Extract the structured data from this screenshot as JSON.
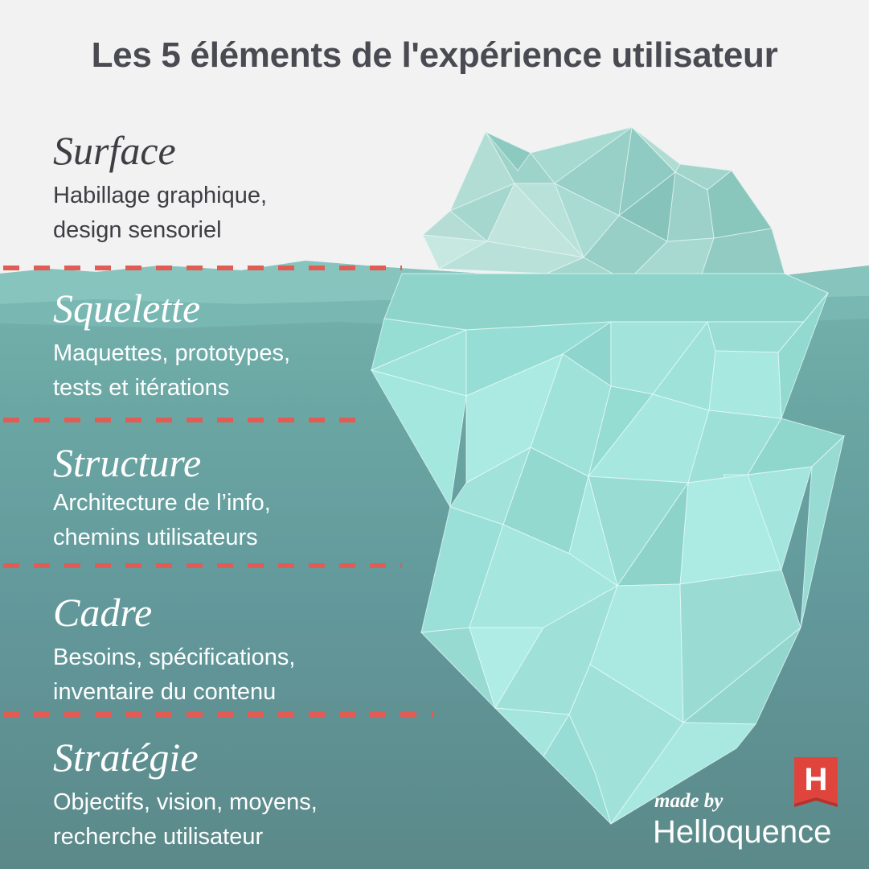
{
  "title": "Les 5 éléments de l'expérience utilisateur",
  "layers": [
    {
      "name": "Surface",
      "line1": "Habillage graphique,",
      "line2": "design sensoriel"
    },
    {
      "name": "Squelette",
      "line1": "Maquettes, prototypes,",
      "line2": "tests et itérations"
    },
    {
      "name": "Structure",
      "line1": "Architecture de l’info,",
      "line2": "chemins utilisateurs"
    },
    {
      "name": "Cadre",
      "line1": "Besoins, spécifications,",
      "line2": "inventaire du contenu"
    },
    {
      "name": "Stratégie",
      "line1": "Objectifs, vision, moyens,",
      "line2": "recherche utilisateur"
    }
  ],
  "branding": {
    "made_by": "made by",
    "name": "Helloquence",
    "logo_letter": "H"
  },
  "colors": {
    "background": "#f2f2f2",
    "water": "#5d8f8e",
    "water_surface": "#86c4bd",
    "ice_light": "#a6e9e2",
    "ice_above": "#a8d8d0",
    "divider": "#e05c55",
    "title_text": "#4a4b52",
    "logo_red": "#e0453d"
  }
}
